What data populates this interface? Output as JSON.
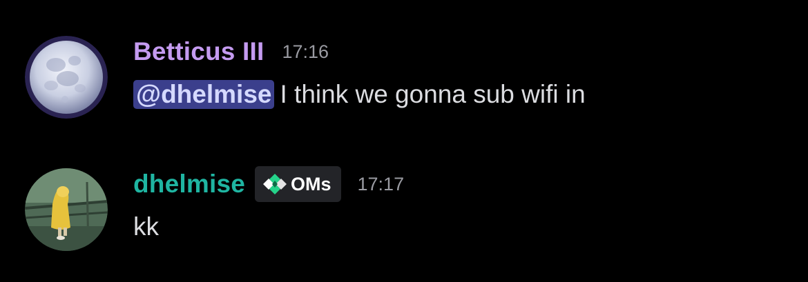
{
  "messages": [
    {
      "username": "Betticus III",
      "time": "17:16",
      "mention": "@dhelmise",
      "text": "I think we gonna sub wifi in",
      "avatar_icon": "moon-avatar",
      "username_color": "#c49bf0"
    },
    {
      "username": "dhelmise",
      "time": "17:17",
      "role_tag": {
        "icon": "diamond-gem-icon",
        "label": "OMs"
      },
      "text": "kk",
      "avatar_icon": "raincoat-child-avatar",
      "username_color": "#1fb5a2"
    }
  ],
  "colors": {
    "background": "#000000",
    "mention_bg": "#3b3f8c",
    "timestamp": "#9a9ba2"
  }
}
